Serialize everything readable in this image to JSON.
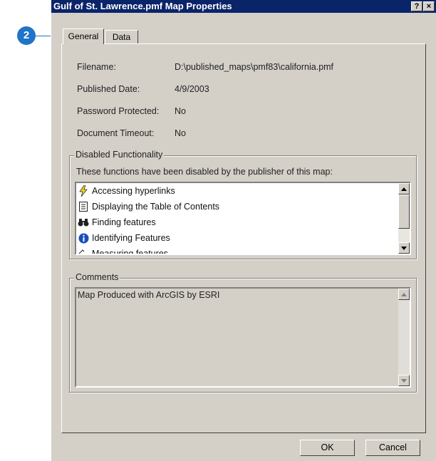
{
  "callout": {
    "number": "2"
  },
  "window": {
    "title": "Gulf of St. Lawrence.pmf Map Properties",
    "help_button": "?",
    "close_button": "×"
  },
  "tabs": [
    {
      "label": "General",
      "active": true
    },
    {
      "label": "Data",
      "active": false
    }
  ],
  "properties": {
    "filename_label": "Filename:",
    "filename_value": "D:\\published_maps\\pmf83\\california.pmf",
    "published_date_label": "Published Date:",
    "published_date_value": "4/9/2003",
    "password_label": "Password Protected:",
    "password_value": "No",
    "timeout_label": "Document Timeout:",
    "timeout_value": "No"
  },
  "disabled_functionality": {
    "legend": "Disabled Functionality",
    "description": "These functions have been disabled by the publisher of this map:",
    "items": [
      {
        "label": "Accessing hyperlinks",
        "icon": "lightning-icon"
      },
      {
        "label": "Displaying the Table of Contents",
        "icon": "document-icon"
      },
      {
        "label": "Finding features",
        "icon": "binoculars-icon"
      },
      {
        "label": "Identifying Features",
        "icon": "info-icon"
      },
      {
        "label": "Measuring features",
        "icon": "ruler-icon"
      }
    ]
  },
  "comments": {
    "legend": "Comments",
    "text": "Map Produced with ArcGIS by ESRI"
  },
  "buttons": {
    "ok": "OK",
    "cancel": "Cancel"
  },
  "colors": {
    "titlebar": "#0a246a",
    "dialog_face": "#d4d0c8",
    "callout": "#1f74c7",
    "info_icon": "#1a4fb8"
  }
}
